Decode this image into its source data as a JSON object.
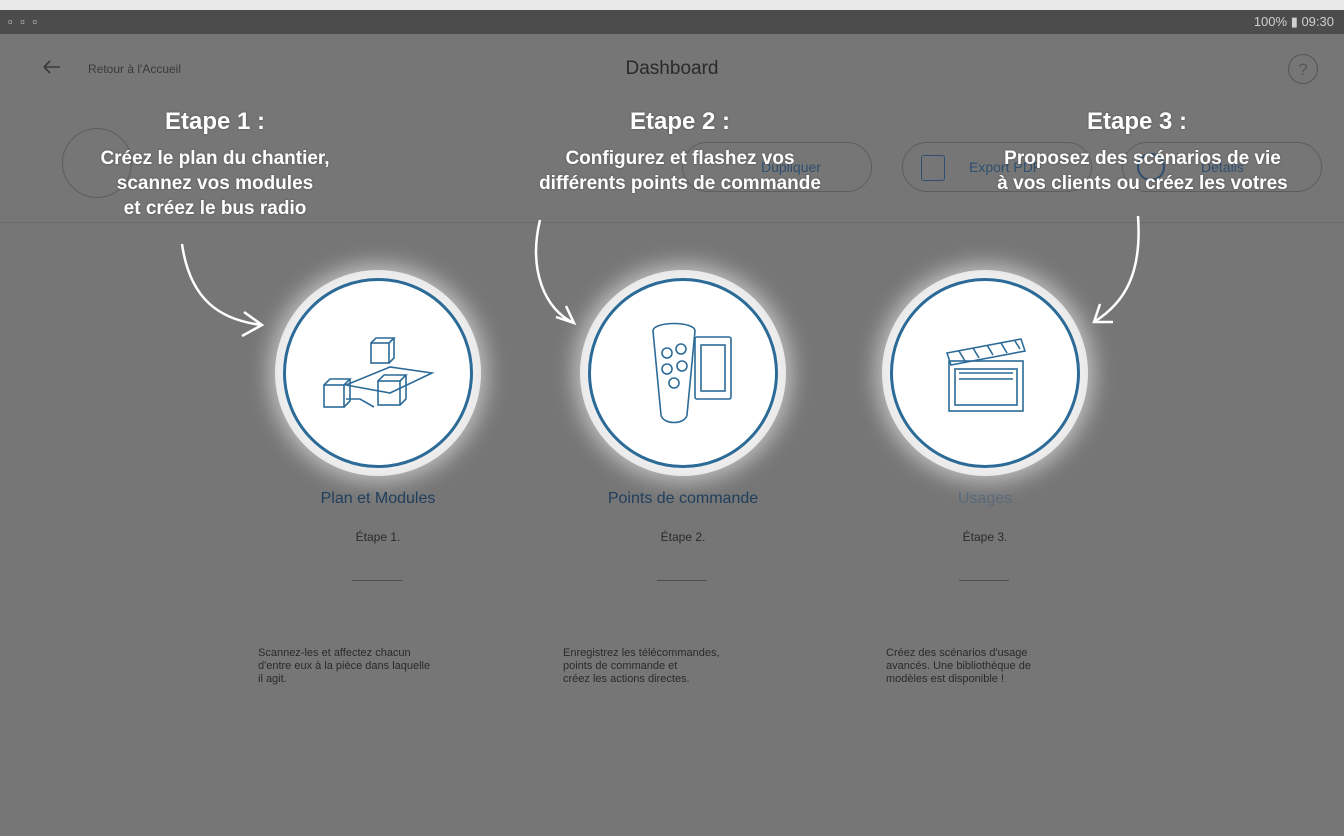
{
  "status_bar": {
    "right_text": "100% ▮ 09:30"
  },
  "header": {
    "back_label": "Retour à l'Accueil",
    "title": "Dashboard",
    "help_label": "?"
  },
  "background_actions": {
    "duplicate_label": "Dupliquer",
    "export_label": "Export PDF",
    "details_label": "Détails"
  },
  "overlay": [
    {
      "title": "Etape 1 :",
      "text": "Créez le plan du chantier,\nscannez vos modules\net créez le bus radio"
    },
    {
      "title": "Etape 2 :",
      "text": "Configurez et flashez vos\ndifférents points de commande"
    },
    {
      "title": "Etape 3 :",
      "text": "Proposez des scénarios de vie\nà vos clients ou créez les votres"
    }
  ],
  "steps": [
    {
      "name": "Plan et Modules",
      "number": "Étape 1.",
      "description": "Scannez-les et affectez chacun\nd'entre eux à la pièce dans laquelle\nil agit.",
      "icon": "modules-icon"
    },
    {
      "name": "Points de commande",
      "number": "Étape 2.",
      "description": "Enregistrez les télécommandes,\npoints de commande et\ncréez les actions directes.",
      "icon": "remote-control-icon"
    },
    {
      "name": "Usages",
      "number": "Étape 3.",
      "description": "Créez des scénarios d'usage\navancés. Une bibliothèque de\nmodèles est disponible !",
      "icon": "clapperboard-icon"
    }
  ]
}
